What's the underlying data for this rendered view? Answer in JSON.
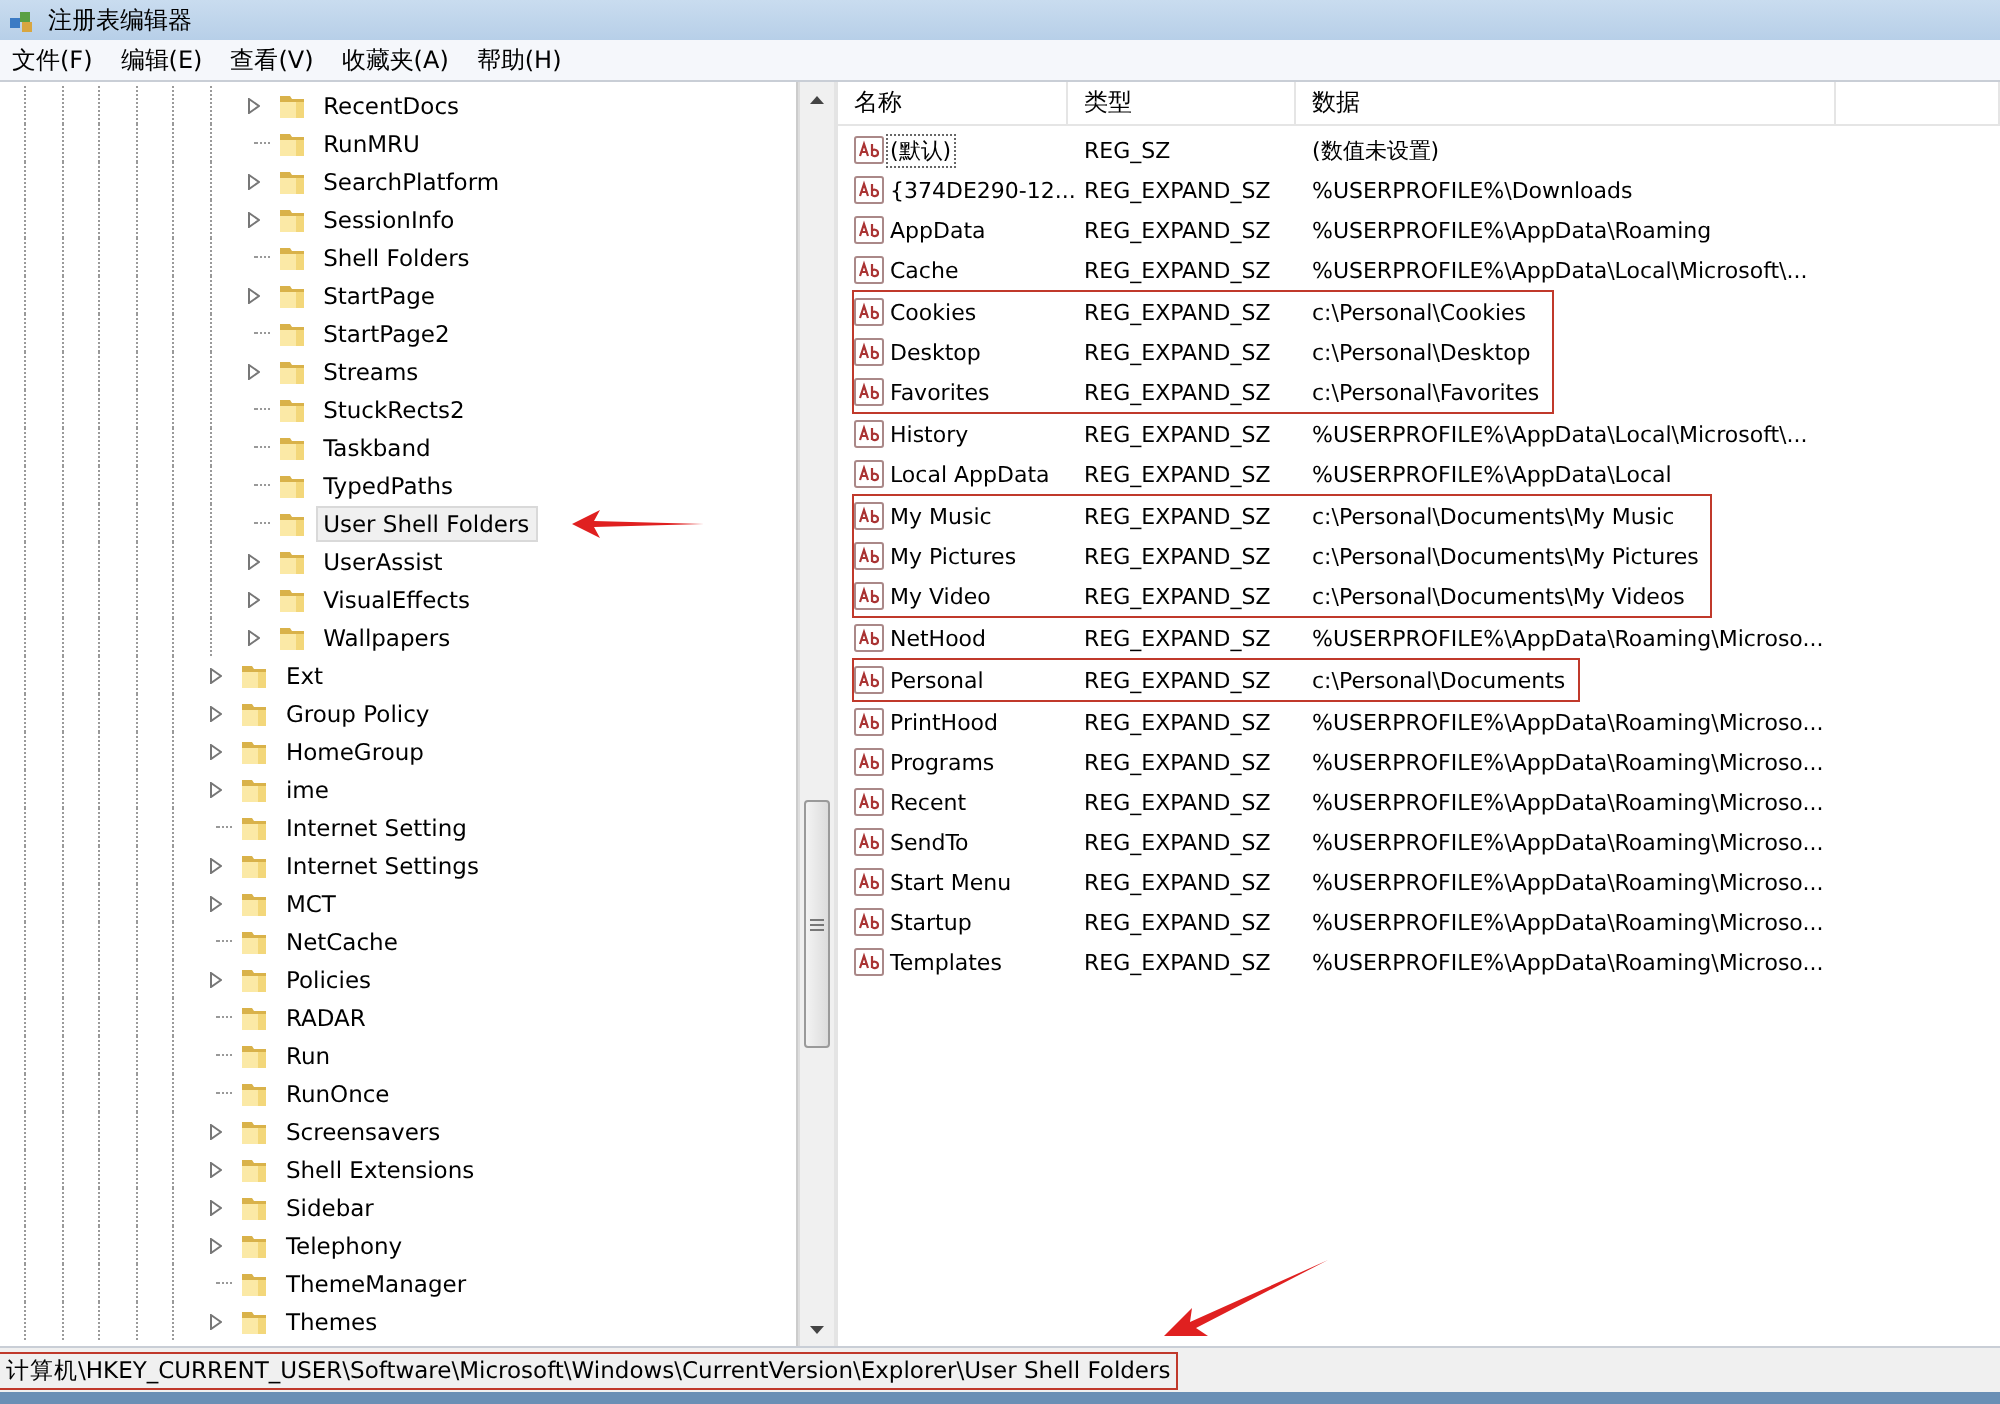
{
  "window": {
    "title": "注册表编辑器"
  },
  "menu": [
    {
      "label": "文件(F)"
    },
    {
      "label": "编辑(E)"
    },
    {
      "label": "查看(V)"
    },
    {
      "label": "收藏夹(A)"
    },
    {
      "label": "帮助(H)"
    }
  ],
  "tree": [
    {
      "children": [
        {
          "label": "RecentDocs",
          "expandable": true,
          "selected": false,
          "arrow": false
        },
        {
          "label": "RunMRU",
          "expandable": false,
          "selected": false,
          "arrow": false
        },
        {
          "label": "SearchPlatform",
          "expandable": true,
          "selected": false,
          "arrow": false
        },
        {
          "label": "SessionInfo",
          "expandable": true,
          "selected": false,
          "arrow": false
        },
        {
          "label": "Shell Folders",
          "expandable": false,
          "selected": false,
          "arrow": false
        },
        {
          "label": "StartPage",
          "expandable": true,
          "selected": false,
          "arrow": false
        },
        {
          "label": "StartPage2",
          "expandable": false,
          "selected": false,
          "arrow": false
        },
        {
          "label": "Streams",
          "expandable": true,
          "selected": false,
          "arrow": false
        },
        {
          "label": "StuckRects2",
          "expandable": false,
          "selected": false,
          "arrow": false
        },
        {
          "label": "Taskband",
          "expandable": false,
          "selected": false,
          "arrow": false
        },
        {
          "label": "TypedPaths",
          "expandable": false,
          "selected": false,
          "arrow": false
        },
        {
          "label": "User Shell Folders",
          "expandable": false,
          "selected": true,
          "arrow": true
        },
        {
          "label": "UserAssist",
          "expandable": true,
          "selected": false,
          "arrow": false
        },
        {
          "label": "VisualEffects",
          "expandable": true,
          "selected": false,
          "arrow": false
        },
        {
          "label": "Wallpapers",
          "expandable": true,
          "selected": false,
          "arrow": false
        }
      ]
    },
    {
      "label": "Ext",
      "expandable": true,
      "selected": false,
      "arrow": false
    },
    {
      "label": "Group Policy",
      "expandable": true,
      "selected": false,
      "arrow": false
    },
    {
      "label": "HomeGroup",
      "expandable": true,
      "selected": false,
      "arrow": false
    },
    {
      "label": "ime",
      "expandable": true,
      "selected": false,
      "arrow": false
    },
    {
      "label": "Internet Setting",
      "expandable": false,
      "selected": false,
      "arrow": false
    },
    {
      "label": "Internet Settings",
      "expandable": true,
      "selected": false,
      "arrow": false
    },
    {
      "label": "MCT",
      "expandable": true,
      "selected": false,
      "arrow": false
    },
    {
      "label": "NetCache",
      "expandable": false,
      "selected": false,
      "arrow": false
    },
    {
      "label": "Policies",
      "expandable": true,
      "selected": false,
      "arrow": false
    },
    {
      "label": "RADAR",
      "expandable": false,
      "selected": false,
      "arrow": false
    },
    {
      "label": "Run",
      "expandable": false,
      "selected": false,
      "arrow": false
    },
    {
      "label": "RunOnce",
      "expandable": false,
      "selected": false,
      "arrow": false
    },
    {
      "label": "Screensavers",
      "expandable": true,
      "selected": false,
      "arrow": false
    },
    {
      "label": "Shell Extensions",
      "expandable": true,
      "selected": false,
      "arrow": false
    },
    {
      "label": "Sidebar",
      "expandable": true,
      "selected": false,
      "arrow": false
    },
    {
      "label": "Telephony",
      "expandable": true,
      "selected": false,
      "arrow": false
    },
    {
      "label": "ThemeManager",
      "expandable": false,
      "selected": false,
      "arrow": false
    },
    {
      "label": "Themes",
      "expandable": true,
      "selected": false,
      "arrow": false
    }
  ],
  "table": {
    "columns": [
      "名称",
      "类型",
      "数据"
    ],
    "rows": [
      {
        "name": "(默认)",
        "type": "REG_SZ",
        "data": "(数值未设置)",
        "focused": true,
        "boxed": false
      },
      {
        "name": "{374DE290-12...",
        "type": "REG_EXPAND_SZ",
        "data": "%USERPROFILE%\\Downloads",
        "focused": false,
        "boxed": false
      },
      {
        "name": "AppData",
        "type": "REG_EXPAND_SZ",
        "data": "%USERPROFILE%\\AppData\\Roaming",
        "focused": false,
        "boxed": false
      },
      {
        "name": "Cache",
        "type": "REG_EXPAND_SZ",
        "data": "%USERPROFILE%\\AppData\\Local\\Microsoft\\...",
        "focused": false,
        "boxed": false
      },
      {
        "name": "Cookies",
        "type": "REG_EXPAND_SZ",
        "data": "c:\\Personal\\Cookies",
        "focused": false,
        "boxed": true
      },
      {
        "name": "Desktop",
        "type": "REG_EXPAND_SZ",
        "data": "c:\\Personal\\Desktop",
        "focused": false,
        "boxed": true
      },
      {
        "name": "Favorites",
        "type": "REG_EXPAND_SZ",
        "data": "c:\\Personal\\Favorites",
        "focused": false,
        "boxed": true
      },
      {
        "name": "History",
        "type": "REG_EXPAND_SZ",
        "data": "%USERPROFILE%\\AppData\\Local\\Microsoft\\...",
        "focused": false,
        "boxed": false
      },
      {
        "name": "Local AppData",
        "type": "REG_EXPAND_SZ",
        "data": "%USERPROFILE%\\AppData\\Local",
        "focused": false,
        "boxed": false
      },
      {
        "name": "My Music",
        "type": "REG_EXPAND_SZ",
        "data": "c:\\Personal\\Documents\\My Music",
        "focused": false,
        "boxed": true
      },
      {
        "name": "My Pictures",
        "type": "REG_EXPAND_SZ",
        "data": "c:\\Personal\\Documents\\My Pictures",
        "focused": false,
        "boxed": true
      },
      {
        "name": "My Video",
        "type": "REG_EXPAND_SZ",
        "data": "c:\\Personal\\Documents\\My Videos",
        "focused": false,
        "boxed": true
      },
      {
        "name": "NetHood",
        "type": "REG_EXPAND_SZ",
        "data": "%USERPROFILE%\\AppData\\Roaming\\Microso...",
        "focused": false,
        "boxed": false
      },
      {
        "name": "Personal",
        "type": "REG_EXPAND_SZ",
        "data": "c:\\Personal\\Documents",
        "focused": false,
        "boxed": true
      },
      {
        "name": "PrintHood",
        "type": "REG_EXPAND_SZ",
        "data": "%USERPROFILE%\\AppData\\Roaming\\Microso...",
        "focused": false,
        "boxed": false
      },
      {
        "name": "Programs",
        "type": "REG_EXPAND_SZ",
        "data": "%USERPROFILE%\\AppData\\Roaming\\Microso...",
        "focused": false,
        "boxed": false
      },
      {
        "name": "Recent",
        "type": "REG_EXPAND_SZ",
        "data": "%USERPROFILE%\\AppData\\Roaming\\Microso...",
        "focused": false,
        "boxed": false
      },
      {
        "name": "SendTo",
        "type": "REG_EXPAND_SZ",
        "data": "%USERPROFILE%\\AppData\\Roaming\\Microso...",
        "focused": false,
        "boxed": false
      },
      {
        "name": "Start Menu",
        "type": "REG_EXPAND_SZ",
        "data": "%USERPROFILE%\\AppData\\Roaming\\Microso...",
        "focused": false,
        "boxed": false
      },
      {
        "name": "Startup",
        "type": "REG_EXPAND_SZ",
        "data": "%USERPROFILE%\\AppData\\Roaming\\Microso...",
        "focused": false,
        "boxed": false
      },
      {
        "name": "Templates",
        "type": "REG_EXPAND_SZ",
        "data": "%USERPROFILE%\\AppData\\Roaming\\Microso...",
        "focused": false,
        "boxed": false
      }
    ]
  },
  "status_bar": {
    "text": "计算机\\HKEY_CURRENT_USER\\Software\\Microsoft\\Windows\\CurrentVersion\\Explorer\\User Shell Folders",
    "boxed": true,
    "arrow": true
  }
}
